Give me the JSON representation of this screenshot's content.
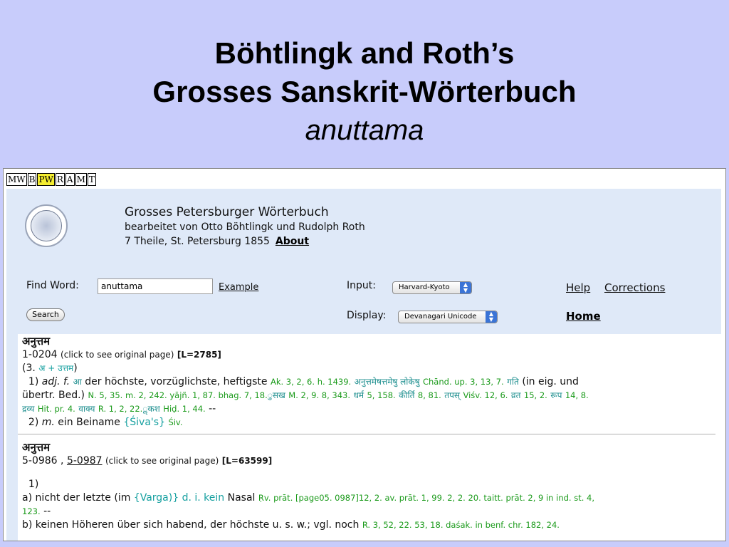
{
  "slide": {
    "title_line1": "Böhtlingk and Roth’s",
    "title_line2": "Grosses Sanskrit-Wörterbuch",
    "title_line3": "anuttama"
  },
  "dict_tabs": [
    "MW",
    "B",
    "PW",
    "R",
    "A",
    "M",
    "T"
  ],
  "dict_tabs_active": "PW",
  "header": {
    "title": "Grosses Petersburger Wörterbuch",
    "subtitle": "bearbeitet von Otto Böhtlingk und Rudolph Roth",
    "publication": "7 Theile, St. Petersburg 1855",
    "about_link": "About"
  },
  "form": {
    "find_word_label": "Find Word:",
    "find_word_value": "anuttama",
    "example_link": "Example",
    "search_button": "Search",
    "input_label": "Input:",
    "input_value": "Harvard-Kyoto",
    "display_label": "Display:",
    "display_value": "Devanagari Unicode",
    "help_link": "Help",
    "corrections_link": "Corrections",
    "home_link": "Home"
  },
  "entry1": {
    "headword": "अनुत्तम",
    "id": "1-0204",
    "click_note": "(click to see original page)",
    "lnum": "[L=2785]",
    "etym_open": "(3.",
    "etym": "अ + उत्तम",
    "etym_close": ")",
    "s1_num": "1)",
    "s1_gram": "adj. f.",
    "s1_deva": "आ",
    "s1_text": "der höchste, vorzüglichste, heftigste",
    "s1_ref1": "Ak. 3, 2, 6. h. 1439.",
    "s1_deva2": "अनुत्तमेषत्तमेषु लोकेषु",
    "s1_ref2": "Chānd. up. 3, 13, 7.",
    "s1_deva3": "गति",
    "s1_text2": "(in eig. und",
    "s1_text3": "übertr. Bed.)",
    "s1_ref3": "N. 5, 35. m. 2, 242. yājñ. 1, 87. bhag. 7, 18.",
    "s1_deva4": "ुसख",
    "s1_ref4": "M. 2, 9. 8, 343.",
    "s1_deva5": "धर्म",
    "s1_ref5": "5, 158.",
    "s1_deva6": "कीर्ति",
    "s1_ref6": "8, 81.",
    "s1_deva7": "तपस्",
    "s1_ref7": "Viśv. 12, 6.",
    "s1_deva8": "व्रत",
    "s1_ref8": "15, 2.",
    "s1_deva9": "रूप",
    "s1_ref9": "14, 8.",
    "s1_deva10": "द्रव्य",
    "s1_ref10": "Hit. pr. 4.",
    "s1_deva11": "वाक्य",
    "s1_ref11": "R. 1, 2, 22.",
    "s1_deva12": "ॢकश",
    "s1_ref12": "Hiḍ. 1, 44.",
    "s1_dash": "--",
    "s2_num": "2)",
    "s2_gram": "m.",
    "s2_text": "ein Beiname",
    "s2_link": "{Śiva's}",
    "s2_ref": "Śiv."
  },
  "entry2": {
    "headword": "अनुत्तम",
    "id": "5-0986",
    "comma": ",",
    "id_link": "5-0987",
    "click_note": "(click to see original page)",
    "lnum": "[L=63599]",
    "s1_num": "1)",
    "a_text": "a) nicht der letzte (im",
    "a_link": "{Varga)}",
    "a_link2": "d. i. kein",
    "a_text2": "Nasal",
    "a_ref": "Ṛv. prāt. [page05. 0987]12, 2. av. prāt. 1, 99. 2, 2. 20. taitt. prāt. 2, 9 in ind. st. 4,",
    "a_ref2": "123.",
    "a_dash": "--",
    "b_text": "b) keinen Höheren über sich habend, der höchste u. s. w.; vgl. noch",
    "b_ref": "R. 3, 52, 22. 53, 18. daśak. in benf. chr. 182, 24."
  }
}
